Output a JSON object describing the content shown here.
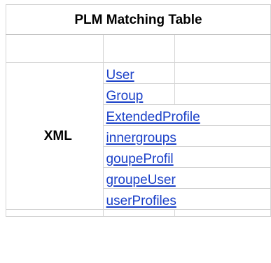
{
  "table": {
    "title": "PLM Matching Table",
    "row_label": "XML",
    "links": [
      "User",
      "Group",
      "ExtendedProfile",
      "innergroups",
      "goupeProfil",
      "groupeUser",
      "userProfiles"
    ]
  }
}
